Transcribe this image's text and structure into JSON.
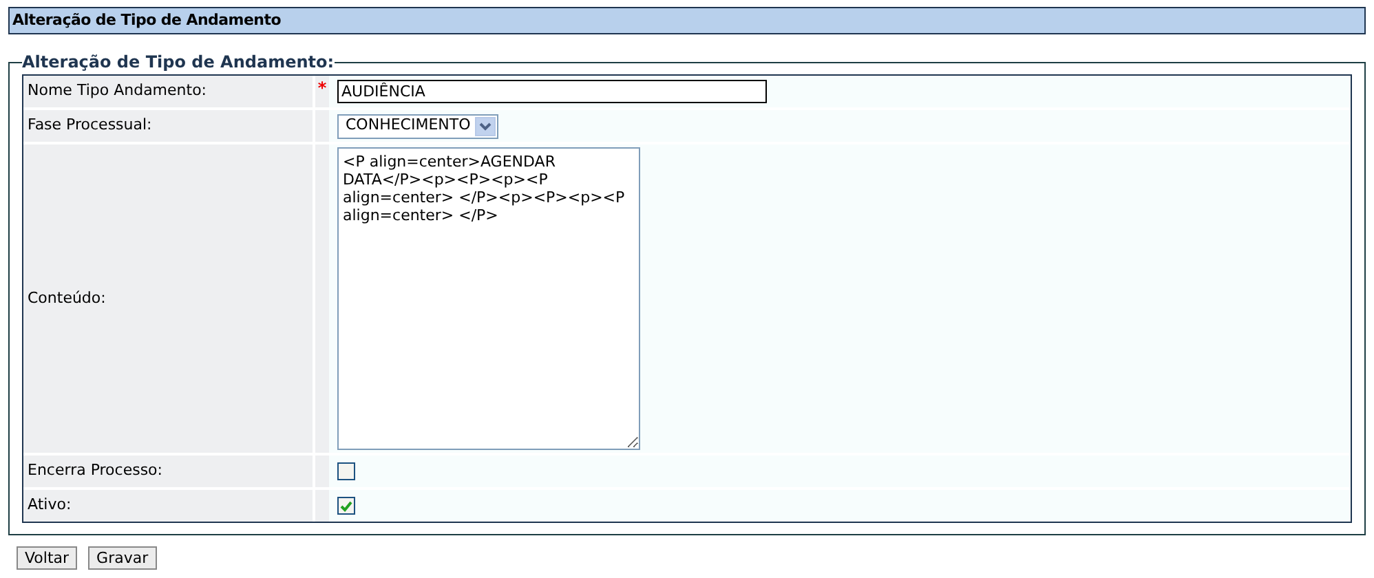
{
  "header": {
    "title": "Alteração de Tipo de Andamento"
  },
  "fieldset": {
    "legend": "Alteração de Tipo de Andamento:",
    "fields": [
      {
        "kind": "text",
        "label": "Nome Tipo Andamento:",
        "marker": "*",
        "value": "AUDIÊNCIA"
      },
      {
        "kind": "select",
        "label": "Fase Processual:",
        "value": "CONHECIMENTO"
      },
      {
        "kind": "textarea",
        "label": "Conteúdo:",
        "value": "<P align=center>AGENDAR DATA</P><p><P><p><P align=center> </P><p><P><p><P align=center> </P>"
      },
      {
        "kind": "checkbox",
        "label": "Encerra Processo:",
        "checked": false
      },
      {
        "kind": "checkbox",
        "label": "Ativo:",
        "checked": true
      }
    ]
  },
  "buttons": [
    "Voltar",
    "Gravar"
  ]
}
